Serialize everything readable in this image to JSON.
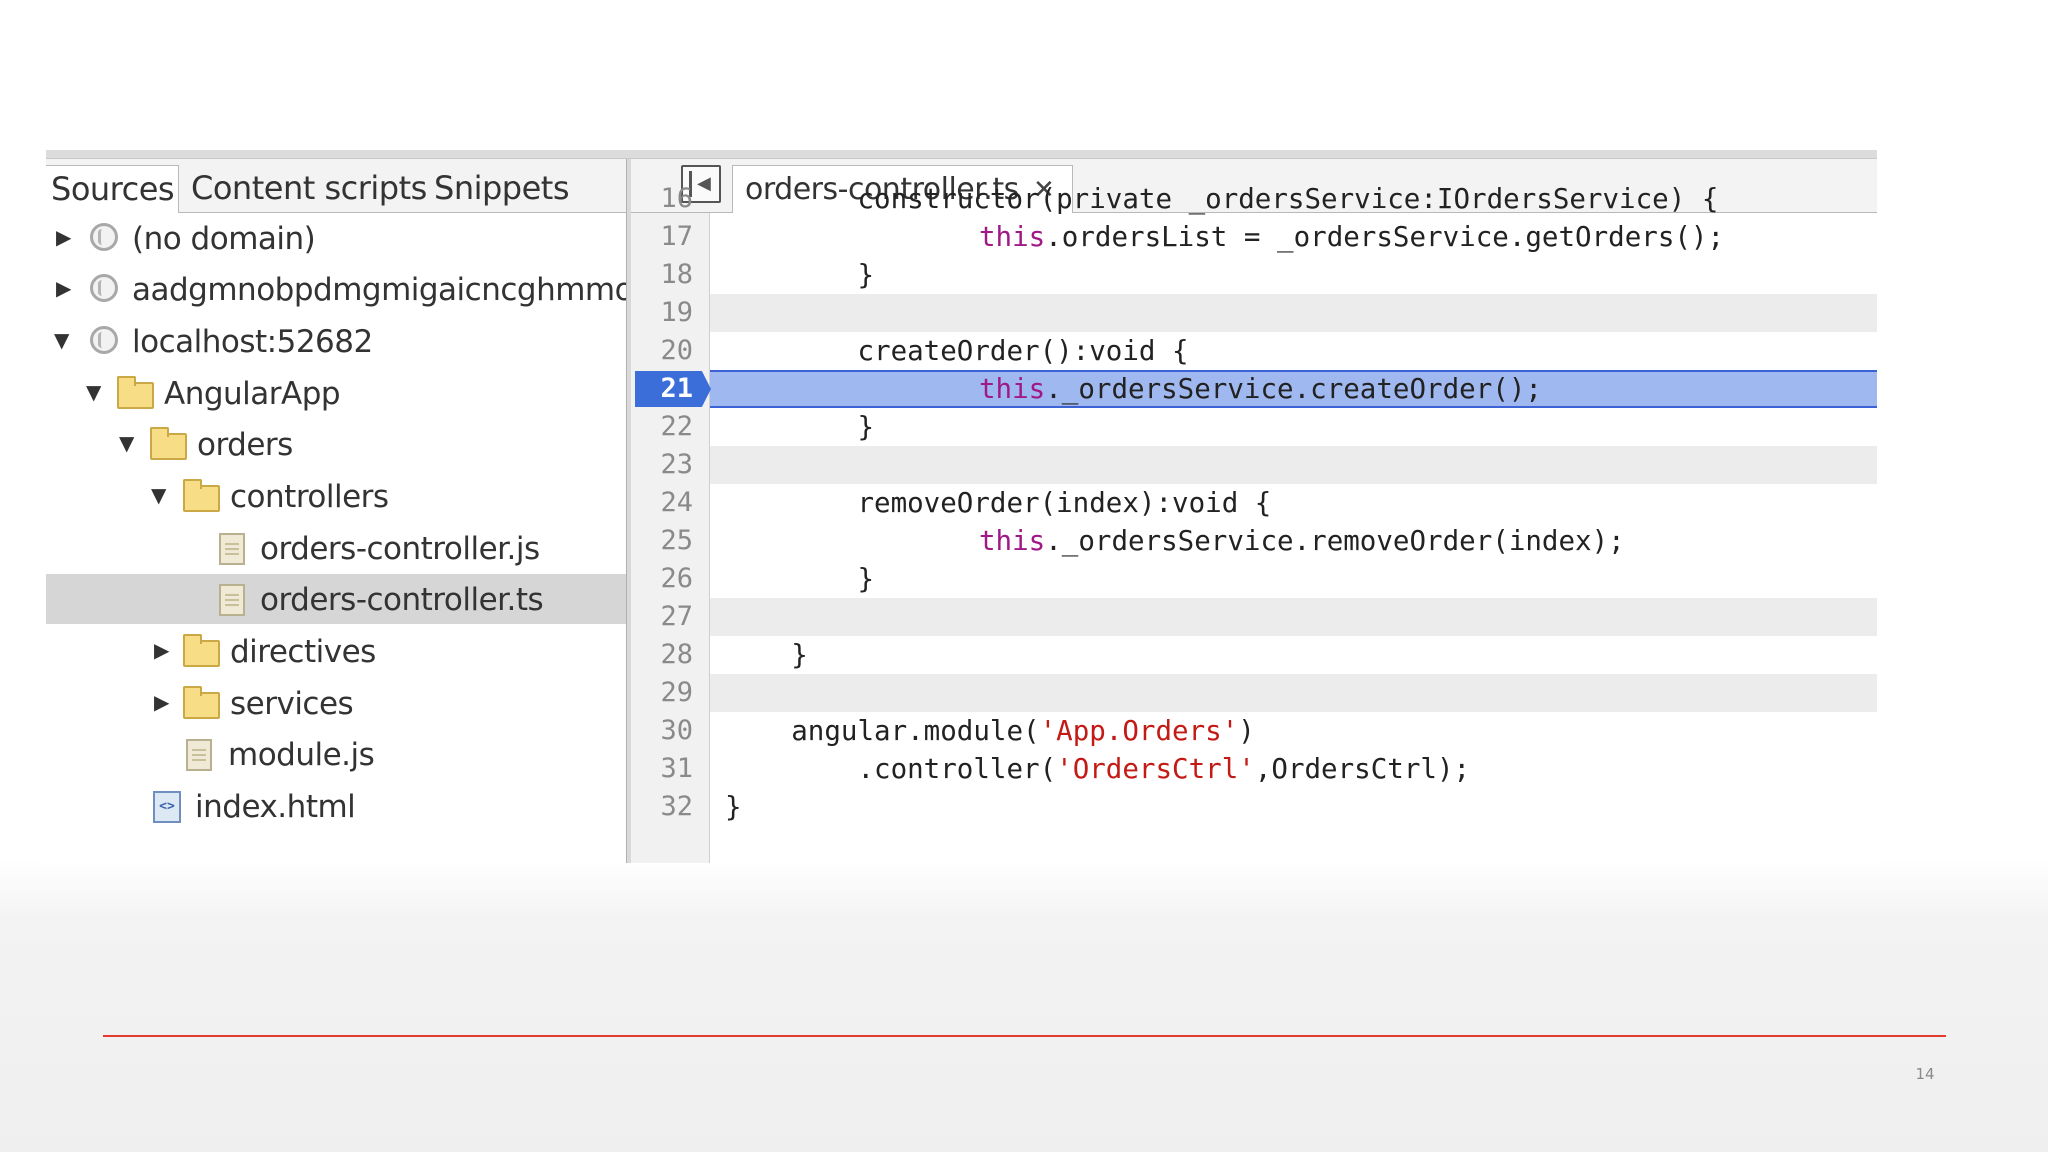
{
  "slide": {
    "page_number": "14",
    "accent_color": "#e23b2e"
  },
  "devtools": {
    "nav_tabs": [
      "Sources",
      "Content scripts",
      "Snippets"
    ],
    "file_tree": [
      {
        "label": "(no domain)",
        "icon": "globe-icon",
        "expanded": false
      },
      {
        "label": "aadgmnobpdmgmigaicncghmmoe",
        "icon": "globe-icon",
        "expanded": false
      },
      {
        "label": "localhost:52682",
        "icon": "globe-icon",
        "expanded": true
      },
      {
        "label": "AngularApp",
        "icon": "folder-icon",
        "expanded": true
      },
      {
        "label": "orders",
        "icon": "folder-icon",
        "expanded": true
      },
      {
        "label": "controllers",
        "icon": "folder-icon",
        "expanded": true
      },
      {
        "label": "orders-controller.js",
        "icon": "file-icon"
      },
      {
        "label": "orders-controller.ts",
        "icon": "file-icon",
        "selected": true
      },
      {
        "label": "directives",
        "icon": "folder-icon",
        "expanded": false
      },
      {
        "label": "services",
        "icon": "folder-icon",
        "expanded": false
      },
      {
        "label": "module.js",
        "icon": "file-icon"
      },
      {
        "label": "index.html",
        "icon": "html-file-icon"
      }
    ],
    "editor": {
      "open_tab": "orders-controller.ts",
      "close_glyph": "✕",
      "breakpoint_line": "21",
      "breakpoint_color": "#3b6ed8",
      "lines": [
        {
          "num": "16",
          "code": "        constructor(private _ordersService:IOrdersService) {"
        },
        {
          "num": "17",
          "kw": "this",
          "code": ".ordersList = _ordersService.getOrders();"
        },
        {
          "num": "18",
          "code": "        }"
        },
        {
          "num": "19",
          "code": ""
        },
        {
          "num": "20",
          "code": "        createOrder():void {"
        },
        {
          "num": "21",
          "kw": "this",
          "code": "._ordersService.createOrder();"
        },
        {
          "num": "22",
          "code": "        }"
        },
        {
          "num": "23",
          "code": ""
        },
        {
          "num": "24",
          "code": "        removeOrder(index):void {"
        },
        {
          "num": "25",
          "kw": "this",
          "code": "._ordersService.removeOrder(index);"
        },
        {
          "num": "26",
          "code": "        }"
        },
        {
          "num": "27",
          "code": ""
        },
        {
          "num": "28",
          "code": "    }"
        },
        {
          "num": "29",
          "code": ""
        },
        {
          "num": "30",
          "pre": "    angular.module(",
          "str": "'App.Orders'",
          "post": ")"
        },
        {
          "num": "31",
          "pre": "        .controller(",
          "str": "'OrdersCtrl'",
          "post": ",OrdersCtrl);"
        },
        {
          "num": "32",
          "code": "}"
        }
      ]
    }
  }
}
